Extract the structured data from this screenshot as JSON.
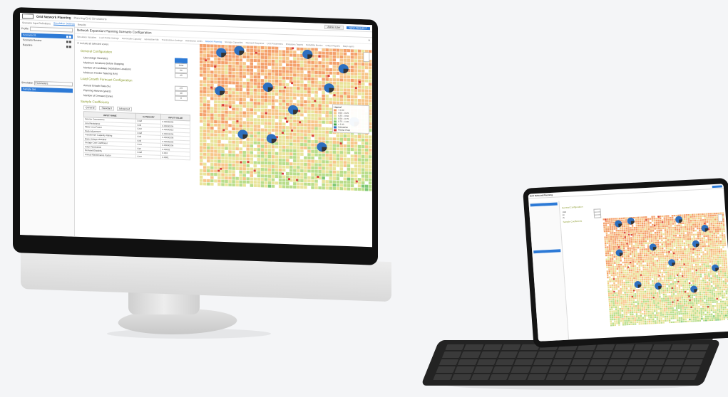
{
  "app": {
    "title": "Grid Network Planning",
    "breadcrumb": "Planning/Grid Simulations",
    "user_button": "Admin User",
    "primary_button": "NEW PROJECT"
  },
  "subtabs": [
    "Scenario Input Definitions",
    "Simulation Settings",
    "Results"
  ],
  "left_panel": {
    "header_label": "Profile",
    "header_select": "select",
    "items": [
      {
        "label": "Scenario 01",
        "selected": true
      },
      {
        "label": "Scenario Review",
        "selected": false
      },
      {
        "label": "Baseline",
        "selected": false
      }
    ],
    "lower_header_label": "Simulation",
    "lower_header_select": "Parameters",
    "lower_items": [
      {
        "label": "Sample Set",
        "selected": true
      }
    ]
  },
  "main": {
    "title": "Network Expansion Planning Scenario Configuration",
    "close": "×",
    "config_tabs": [
      "Simulation Variables",
      "Load Profile Settings",
      "Renewable Capacity",
      "Generation Mix",
      "Transmission Settings",
      "Distribution Limits",
      "Network Planning",
      "Storage Capacities",
      "Demand Response",
      "Cost Parameters",
      "Emissions Targets",
      "Reliability Metrics",
      "Output Reports",
      "Map Layers"
    ],
    "active_config_tab": 6,
    "checkline": "Include all selected zones",
    "sections": [
      {
        "title": "General Configuration",
        "rows": [
          {
            "label": "Use Design Heuristics",
            "value": ""
          },
          {
            "label": "Maximum Iterations Before Stopping",
            "value": "1000"
          },
          {
            "label": "Number of Candidate Substation Locations",
            "value": "50"
          },
          {
            "label": "Minimum Feeder Spacing (km)",
            "value": "25"
          }
        ]
      },
      {
        "title": "Load Growth Forecast Configuration",
        "rows": [
          {
            "label": "Annual Growth Rate (%)",
            "value": "2.5"
          },
          {
            "label": "Planning Horizon (years)",
            "value": "10"
          },
          {
            "label": "Number of Demand Zones",
            "value": "8"
          }
        ]
      }
    ],
    "grid_section_title": "Sample Coefficients",
    "grid_tabs": [
      "General",
      "Standard",
      "Advanced"
    ],
    "grid_columns": [
      "INPUT NAME",
      "CATEGORY",
      "INPUT VALUE"
    ],
    "grid_rows": [
      [
        "Service Connections",
        "Load",
        "0.00000256"
      ],
      [
        "Line Resistance",
        "Grid",
        "0.00000256"
      ],
      [
        "Meter Cost Factor",
        "Cost",
        "0.00000315"
      ],
      [
        "Peak Adjustment",
        "Load",
        "0.00001256"
      ],
      [
        "Transformer Capacity Rating",
        "Grid",
        "0.00000258"
      ],
      [
        "Base Voltage Multiplier",
        "Grid",
        "0.00000256"
      ],
      [
        "Outage Cost Coefficient",
        "Cost",
        "0.00000256"
      ],
      [
        "Solar Penetration",
        "Gen",
        "0.00002"
      ],
      [
        "Demand Elasticity",
        "Load",
        "0.003"
      ],
      [
        "Annual Maintenance Factor",
        "Cost",
        "0.0001"
      ]
    ],
    "legend": {
      "title": "Legend",
      "entries": [
        {
          "label": "< 0.00",
          "color": "#f4a06b"
        },
        {
          "label": "0.00 – 0.25",
          "color": "#f7c68a"
        },
        {
          "label": "0.25 – 0.50",
          "color": "#e9e49a"
        },
        {
          "label": "0.50 – 0.75",
          "color": "#b9dd8a"
        },
        {
          "label": "0.75 – 1.00",
          "color": "#7dc874"
        },
        {
          "label": "> 1.00",
          "color": "#3fa34d"
        },
        {
          "label": "Substation",
          "color": "#2d6fbf"
        },
        {
          "label": "Feeder Point",
          "color": "#d83b3b"
        }
      ]
    }
  },
  "colors": {
    "accent": "#2d7ad6",
    "section_title": "#8a9a2c",
    "map_orange": "#f4a06b",
    "map_green": "#7dc874",
    "map_blue": "#2d6fbf",
    "map_red": "#d83b3b"
  },
  "icons": {
    "zoom_control": "zoom-control-icon",
    "close": "close-icon"
  }
}
